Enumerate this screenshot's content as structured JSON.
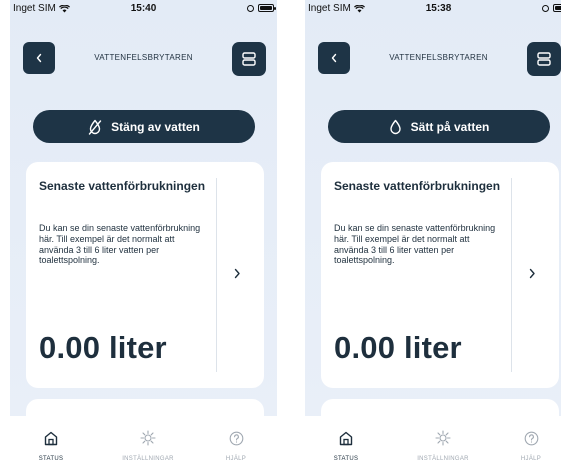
{
  "screens": [
    {
      "status_bar": {
        "carrier": "Inget SIM",
        "time": "15:40"
      },
      "header": {
        "title": "VATTENFELSBRYTAREN"
      },
      "main_button": {
        "label": "Stäng av vatten",
        "icon": "water-off-icon"
      },
      "usage_card": {
        "title": "Senaste vattenförbrukningen",
        "description": "Du kan se din senaste vattenförbrukning här. Till exempel är det normalt att använda 3 till 6 liter vatten per toalettspolning.",
        "value": "0.00 liter"
      },
      "tabs": [
        {
          "label": "STATUS",
          "icon": "home-icon",
          "active": true
        },
        {
          "label": "INSTÄLLNINGAR",
          "icon": "gear-icon",
          "active": false
        },
        {
          "label": "HJÄLP",
          "icon": "help-icon",
          "active": false
        }
      ]
    },
    {
      "status_bar": {
        "carrier": "Inget SIM",
        "time": "15:38"
      },
      "header": {
        "title": "VATTENFELSBRYTAREN"
      },
      "main_button": {
        "label": "Sätt på vatten",
        "icon": "water-drop-icon"
      },
      "usage_card": {
        "title": "Senaste vattenförbrukningen",
        "description": "Du kan se din senaste vattenförbrukning här. Till exempel är det normalt att använda 3 till 6 liter vatten per toalettspolning.",
        "value": "0.00 liter"
      },
      "tabs": [
        {
          "label": "STATUS",
          "icon": "home-icon",
          "active": true
        },
        {
          "label": "INSTÄLLNINGAR",
          "icon": "gear-icon",
          "active": false
        },
        {
          "label": "HJÄLP",
          "icon": "help-icon",
          "active": false
        }
      ]
    }
  ],
  "colors": {
    "primary_dark": "#1e3446",
    "background": "#e6edf7",
    "card": "#ffffff",
    "tab_inactive": "#a0a8b1"
  }
}
